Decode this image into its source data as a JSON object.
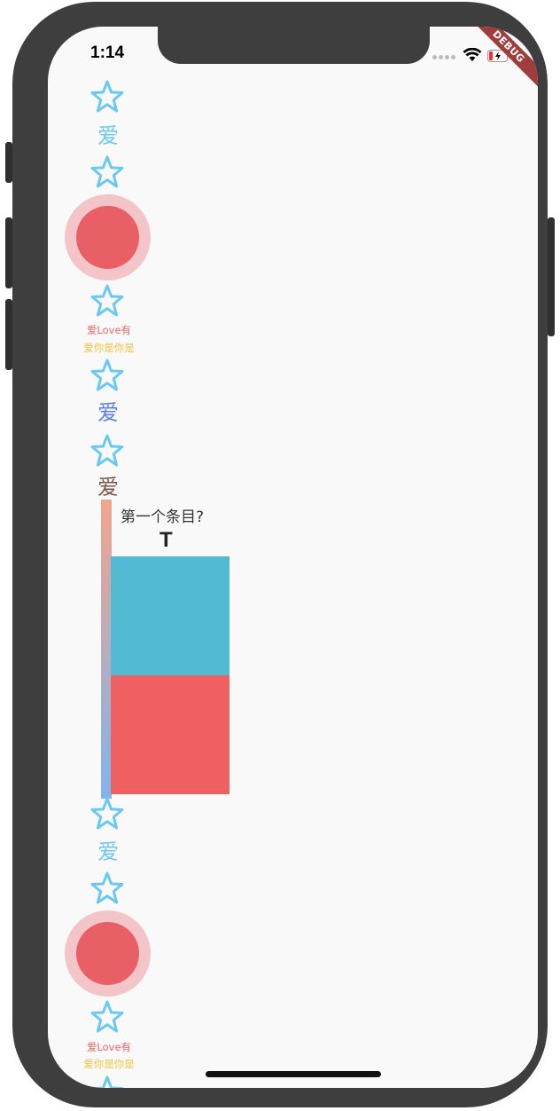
{
  "status_bar": {
    "time": "1:14"
  },
  "debug_banner": "DEBUG",
  "list": {
    "ai_char": "爱",
    "small_red": "爱Love有",
    "small_yellow": "爱你是你是",
    "item_title": "第一个条目?",
    "item_letter": "T"
  },
  "colors": {
    "star": "#6ac8f4",
    "ai_light_blue": "#6ac8f4",
    "ai_blue": "#5a7cf0",
    "ai_brown": "#7b5548",
    "circle": "#e85f66",
    "box_blue": "#53bad3",
    "box_red": "#ef6161"
  },
  "icons": [
    "star-icon",
    "wifi-icon",
    "battery-icon"
  ]
}
